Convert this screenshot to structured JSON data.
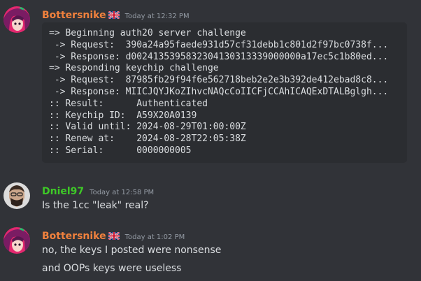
{
  "messages": [
    {
      "username": "Bottersnike",
      "username_color": "#f0813d",
      "flag": "uk-flag-icon",
      "timestamp": "Today at 12:32 PM",
      "code_lines": [
        "=> Beginning auth20 server challenge",
        " -> Request:  390a24a95faede931d57cf31debb1c801d2f97bc0738f...",
        " -> Response: d0024135395832304130313339000000a17ec5c1b80ed...",
        "=> Responding keychip challenge",
        " -> Request:  87985fb29f94f6e562718beb2e2e3b392de412ebad8c8...",
        " -> Response: MIICJQYJKoZIhvcNAQcCoIICFjCCAhICAQExDTALBglgh...",
        ":: Result:      Authenticated",
        ":: Keychip ID:  A59X20A0139",
        ":: Valid until: 2024-08-29T01:00:00Z",
        ":: Renew at:    2024-08-28T22:05:38Z",
        ":: Serial:      0000000005"
      ]
    },
    {
      "username": "Dniel97",
      "username_color": "#3ec927",
      "timestamp": "Today at 12:58 PM",
      "text": "Is the 1cc \"leak\" real?"
    },
    {
      "username": "Bottersnike",
      "username_color": "#f0813d",
      "flag": "uk-flag-icon",
      "timestamp": "Today at 1:02 PM",
      "lines": [
        "no, the keys I posted were nonsense",
        "and OOPs keys were useless"
      ]
    }
  ]
}
